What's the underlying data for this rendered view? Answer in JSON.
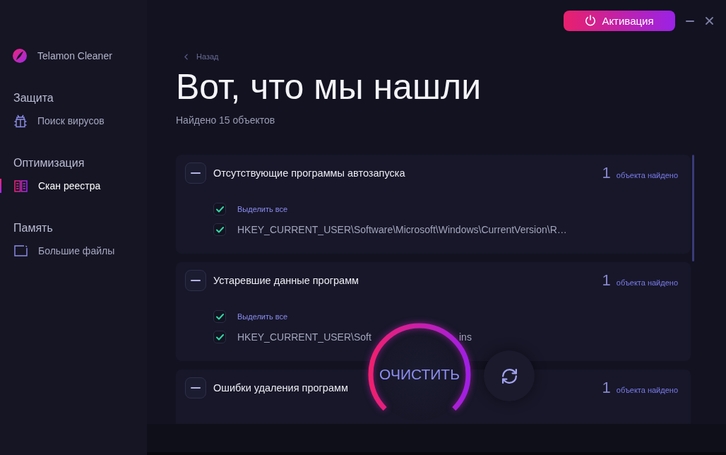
{
  "window": {
    "activation_button": "Активация"
  },
  "sidebar": {
    "app_name": "Telamon Cleaner",
    "sections": [
      {
        "title": "Защита",
        "items": [
          {
            "label": "Поиск вирусов",
            "kind": "bug",
            "selected": false
          }
        ]
      },
      {
        "title": "Оптимизация",
        "items": [
          {
            "label": "Скан реестра",
            "kind": "book",
            "selected": true
          }
        ]
      },
      {
        "title": "Память",
        "items": [
          {
            "label": "Большие файлы",
            "kind": "folder",
            "selected": false
          }
        ]
      }
    ]
  },
  "back_link": "Назад",
  "heading": "Вот, что мы нашли",
  "summary": "Найдено 15 объектов",
  "groups": [
    {
      "title": "Отсутствующие программы автозапуска",
      "expanded": true,
      "count": "1",
      "count_label": "объекта найдено",
      "items": [
        {
          "kind": "select_all",
          "label": "Выделить все",
          "checked": true
        },
        {
          "kind": "path",
          "label": "HKEY_CURRENT_USER\\Software\\Microsoft\\Windows\\CurrentVersion\\R…",
          "checked": true
        }
      ]
    },
    {
      "title": "Устаревшие данные программ",
      "expanded": true,
      "count": "1",
      "count_label": "объекта найдено",
      "items": [
        {
          "kind": "select_all",
          "label": "Выделить все",
          "checked": true
        },
        {
          "kind": "path",
          "visible_parts": [
            "HKEY_CURRENT_USER\\Soft",
            "ins"
          ],
          "checked": true
        }
      ]
    },
    {
      "title": "Ошибки удаления программ",
      "expanded": true,
      "count": "1",
      "count_label": "объекта найдено"
    }
  ],
  "clean_button": "ОЧИСТИТЬ"
}
